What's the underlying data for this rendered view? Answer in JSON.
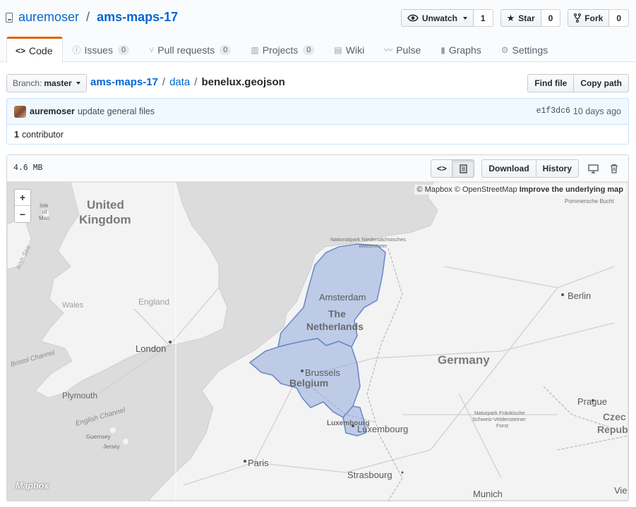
{
  "repo": {
    "owner": "auremoser",
    "name": "ams-maps-17"
  },
  "actions": {
    "watch": {
      "label": "Unwatch",
      "count": "1"
    },
    "star": {
      "label": "Star",
      "count": "0"
    },
    "fork": {
      "label": "Fork",
      "count": "0"
    }
  },
  "nav": [
    {
      "label": "Code",
      "icon": "code-icon"
    },
    {
      "label": "Issues",
      "count": "0",
      "icon": "issue-icon"
    },
    {
      "label": "Pull requests",
      "count": "0",
      "icon": "pull-request-icon"
    },
    {
      "label": "Projects",
      "count": "0",
      "icon": "project-icon"
    },
    {
      "label": "Wiki",
      "icon": "book-icon"
    },
    {
      "label": "Pulse",
      "icon": "pulse-icon"
    },
    {
      "label": "Graphs",
      "icon": "graph-icon"
    },
    {
      "label": "Settings",
      "icon": "gear-icon"
    }
  ],
  "branch": {
    "prefix": "Branch:",
    "name": "master"
  },
  "breadcrumb": {
    "root": "ams-maps-17",
    "folder": "data",
    "file": "benelux.geojson"
  },
  "file_actions": {
    "find": "Find file",
    "copy": "Copy path"
  },
  "commit": {
    "author": "auremoser",
    "message": "update general files",
    "sha": "e1f3dc6",
    "time": "10 days ago"
  },
  "contributors": {
    "count": "1",
    "label": "contributor"
  },
  "file": {
    "size": "4.6 MB",
    "download": "Download",
    "history": "History"
  },
  "map": {
    "attribution": {
      "mapbox": "© Mapbox",
      "osm": "© OpenStreetMap",
      "improve": "Improve the underlying map"
    },
    "zoom_in": "+",
    "zoom_out": "−",
    "logo": "Mapbox",
    "highlight_color": "#8fa9dc",
    "labels": {
      "uk1": "United",
      "uk2": "Kingdom",
      "isle1": "Isle",
      "isle2": "of",
      "isle3": "Man",
      "irish_sea": "Irish Sea",
      "wales": "Wales",
      "england": "England",
      "london": "London",
      "bristol": "Bristol Channel",
      "plymouth": "Plymouth",
      "english_channel": "English Channel",
      "guernsey": "Guernsey",
      "jersey": "Jersey",
      "wadden1": "Nationalpark Niedersächsisches",
      "wadden2": "Wattenmeer",
      "amsterdam": "Amsterdam",
      "nl1": "The",
      "nl2": "Netherlands",
      "brussels": "Brussels",
      "belgium": "Belgium",
      "luxembourg_country": "Luxembourg",
      "luxembourg_city": "Luxembourg",
      "germany": "Germany",
      "berlin": "Berlin",
      "pommersche": "Pommersche Bucht",
      "paris": "Paris",
      "strasbourg": "Strasbourg",
      "munich": "Munich",
      "prague": "Prague",
      "czech1": "Czec",
      "czech2": "Repub",
      "franken1": "Naturpark Fränkische",
      "franken2": "Schweiz-Veldensteiner",
      "franken3": "Forst",
      "vienna": "Vie"
    }
  }
}
